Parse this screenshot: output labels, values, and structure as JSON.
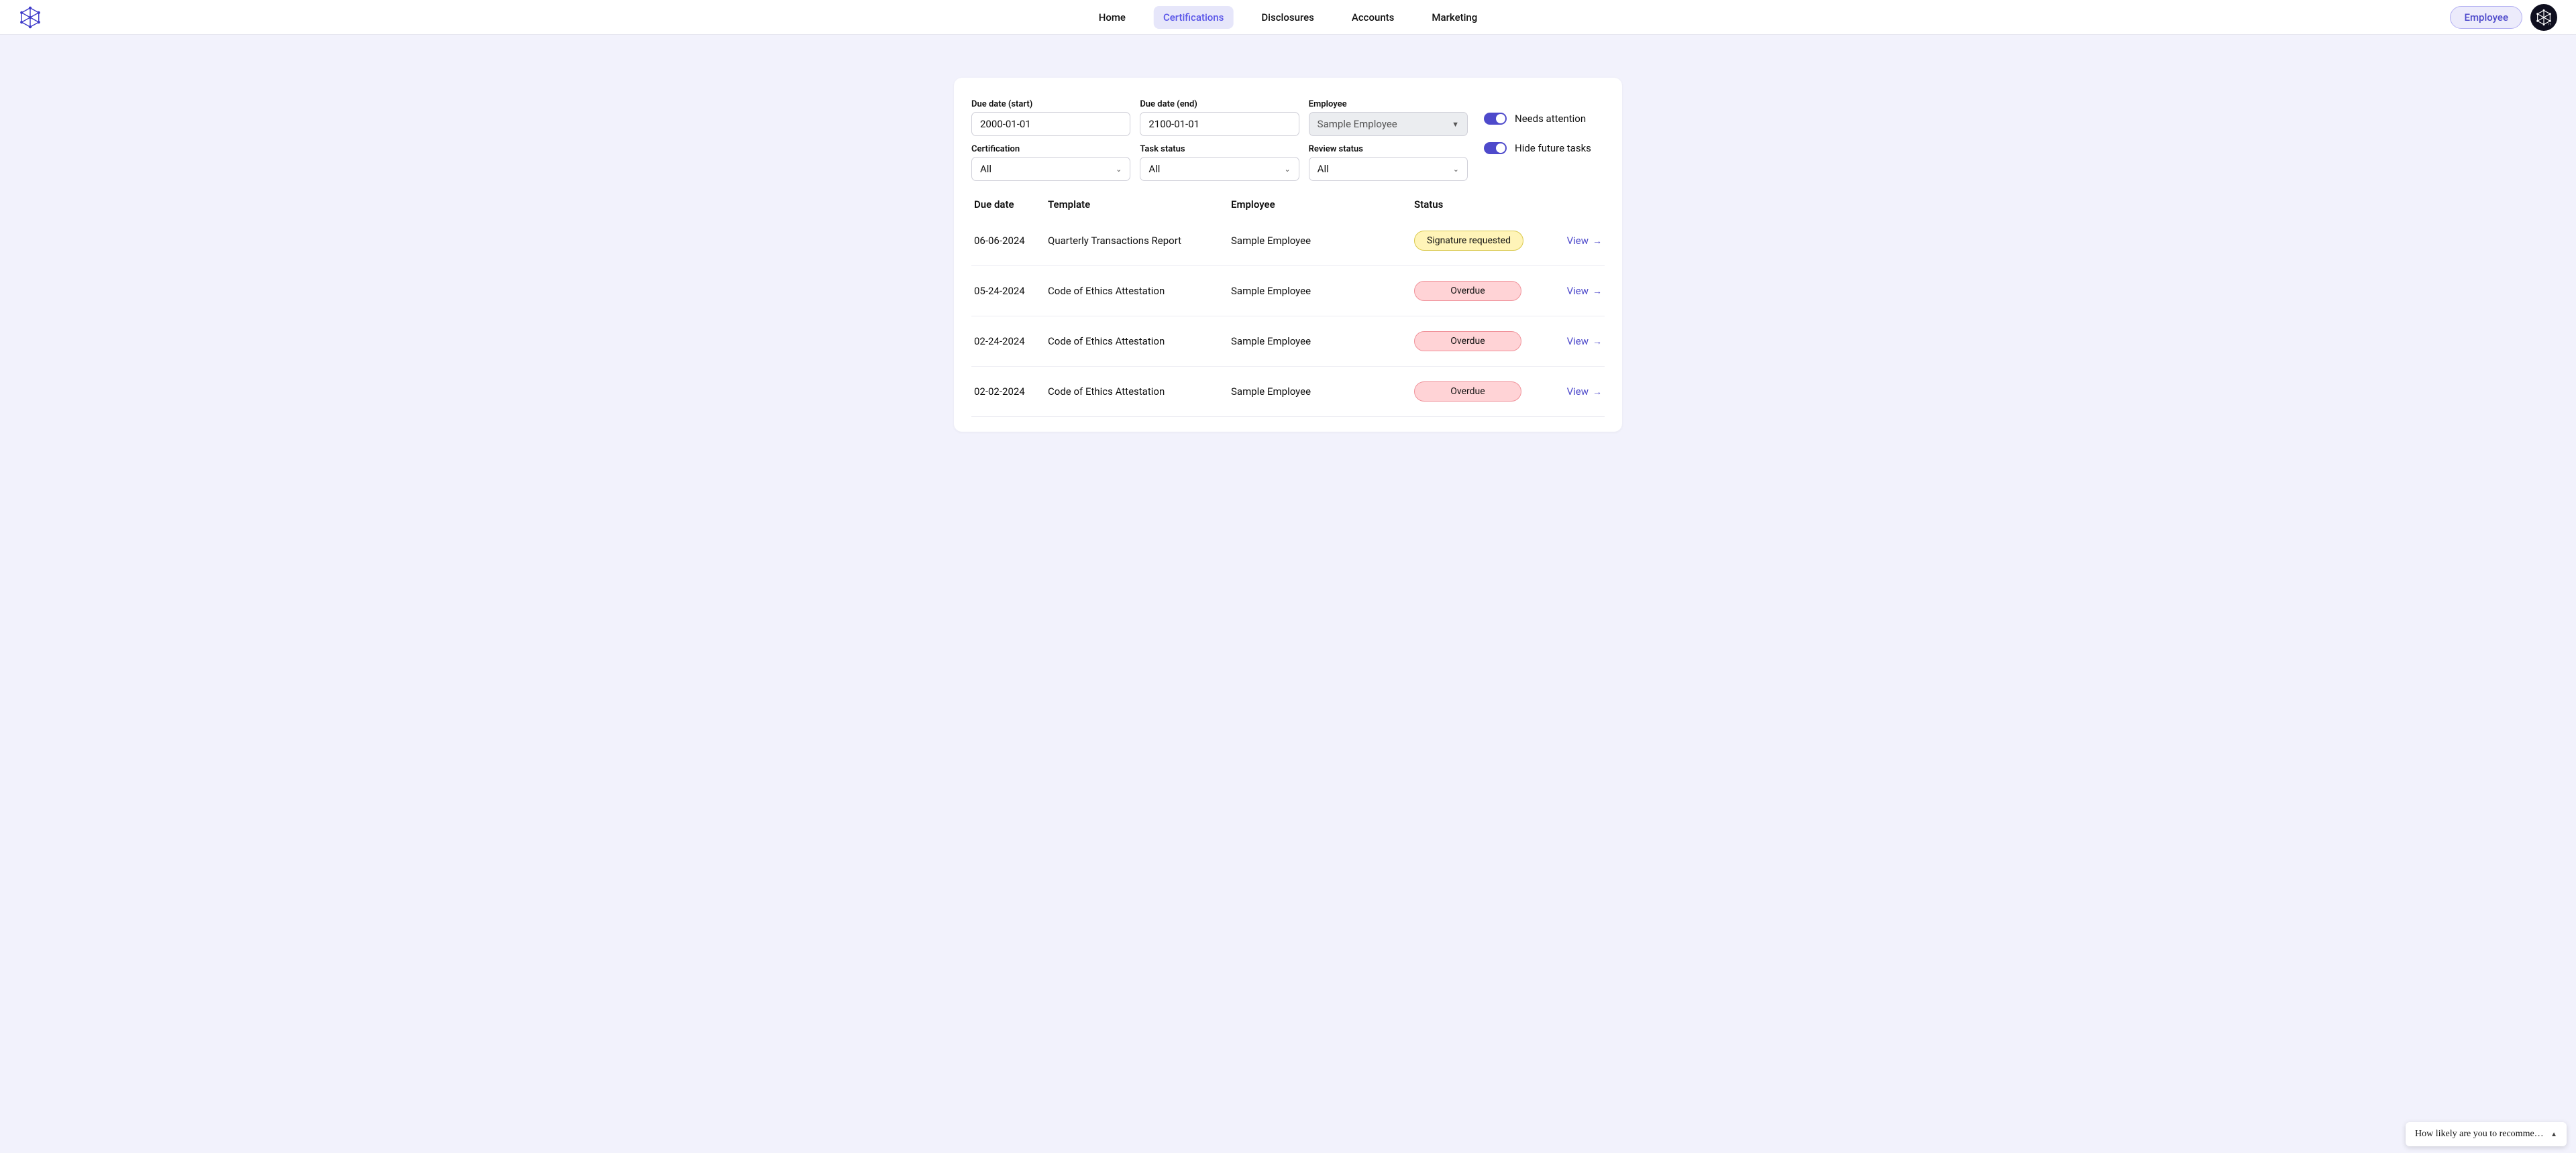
{
  "nav": {
    "items": [
      "Home",
      "Certifications",
      "Disclosures",
      "Accounts",
      "Marketing"
    ],
    "active_index": 1,
    "employee_button": "Employee"
  },
  "filters": {
    "due_start": {
      "label": "Due date (start)",
      "value": "2000-01-01"
    },
    "due_end": {
      "label": "Due date (end)",
      "value": "2100-01-01"
    },
    "employee": {
      "label": "Employee",
      "value": "Sample Employee"
    },
    "certification": {
      "label": "Certification",
      "value": "All"
    },
    "task_status": {
      "label": "Task status",
      "value": "All"
    },
    "review_status": {
      "label": "Review status",
      "value": "All"
    },
    "needs_attention": {
      "label": "Needs attention",
      "on": true
    },
    "hide_future": {
      "label": "Hide future tasks",
      "on": true
    }
  },
  "table": {
    "headers": {
      "due": "Due date",
      "template": "Template",
      "employee": "Employee",
      "status": "Status"
    },
    "view_label": "View",
    "rows": [
      {
        "due": "06-06-2024",
        "template": "Quarterly Transactions Report",
        "employee": "Sample Employee",
        "status": "Signature requested",
        "status_color": "yellow"
      },
      {
        "due": "05-24-2024",
        "template": "Code of Ethics Attestation",
        "employee": "Sample Employee",
        "status": "Overdue",
        "status_color": "red"
      },
      {
        "due": "02-24-2024",
        "template": "Code of Ethics Attestation",
        "employee": "Sample Employee",
        "status": "Overdue",
        "status_color": "red"
      },
      {
        "due": "02-02-2024",
        "template": "Code of Ethics Attestation",
        "employee": "Sample Employee",
        "status": "Overdue",
        "status_color": "red"
      }
    ]
  },
  "feedback_widget": {
    "text": "How likely are you to recommen…"
  }
}
